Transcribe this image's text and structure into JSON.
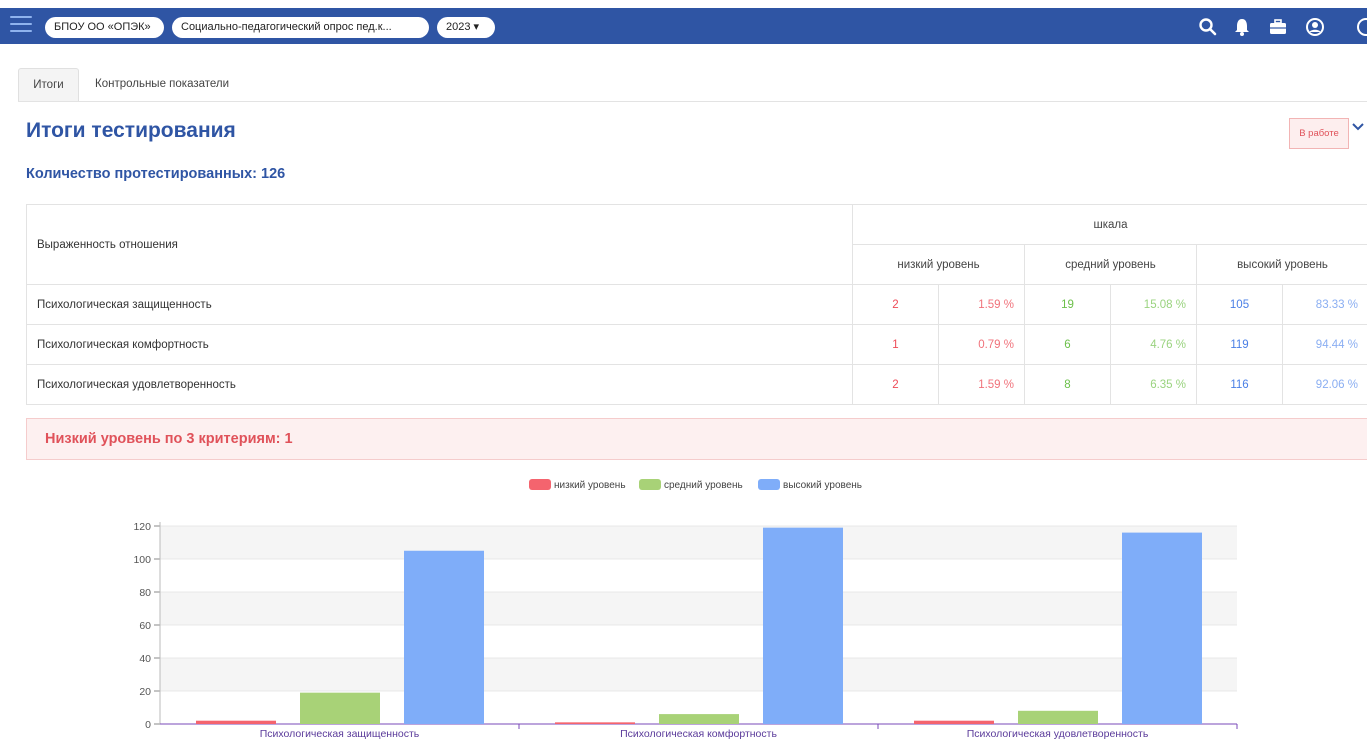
{
  "topbar": {
    "org": "БПОУ ОО «ОПЭК»",
    "survey": "Социально-педагогический опрос пед.к...",
    "year": "2023 ▾"
  },
  "tabs": [
    {
      "label": "Итоги",
      "active": true
    },
    {
      "label": "Контрольные показатели",
      "active": false
    }
  ],
  "page": {
    "title": "Итоги тестирования",
    "status": "В работе",
    "count_label": "Количество протестированных: 126"
  },
  "table": {
    "criterion_header": "Выраженность отношения",
    "scale_header": "шкала",
    "levels": [
      "низкий уровень",
      "средний уровень",
      "высокий уровень"
    ],
    "rows": [
      {
        "name": "Психологическая защищенность",
        "low": "2",
        "low_pct": "1.59 %",
        "mid": "19",
        "mid_pct": "15.08 %",
        "high": "105",
        "high_pct": "83.33 %"
      },
      {
        "name": "Психологическая комфортность",
        "low": "1",
        "low_pct": "0.79 %",
        "mid": "6",
        "mid_pct": "4.76 %",
        "high": "119",
        "high_pct": "94.44 %"
      },
      {
        "name": "Психологическая удовлетворенность",
        "low": "2",
        "low_pct": "1.59 %",
        "mid": "8",
        "mid_pct": "6.35 %",
        "high": "116",
        "high_pct": "92.06 %"
      }
    ]
  },
  "alert": {
    "text": "Низкий уровень по 3 критериям: 1"
  },
  "colors": {
    "low": "#f4646e",
    "mid": "#a8d277",
    "high": "#7fadf9",
    "brand": "#2f55a4"
  },
  "chart_data": {
    "type": "bar",
    "categories": [
      "Психологическая защищенность",
      "Психологическая комфортность",
      "Психологическая удовлетворенность"
    ],
    "series": [
      {
        "name": "низкий уровень",
        "values": [
          2,
          1,
          2
        ]
      },
      {
        "name": "средний уровень",
        "values": [
          19,
          6,
          8
        ]
      },
      {
        "name": "высокий уровень",
        "values": [
          105,
          119,
          116
        ]
      }
    ],
    "yticks": [
      "0",
      "20",
      "40",
      "60",
      "80",
      "100",
      "120"
    ],
    "ylim": [
      0,
      120
    ],
    "legend": "top-center",
    "grid": true
  }
}
